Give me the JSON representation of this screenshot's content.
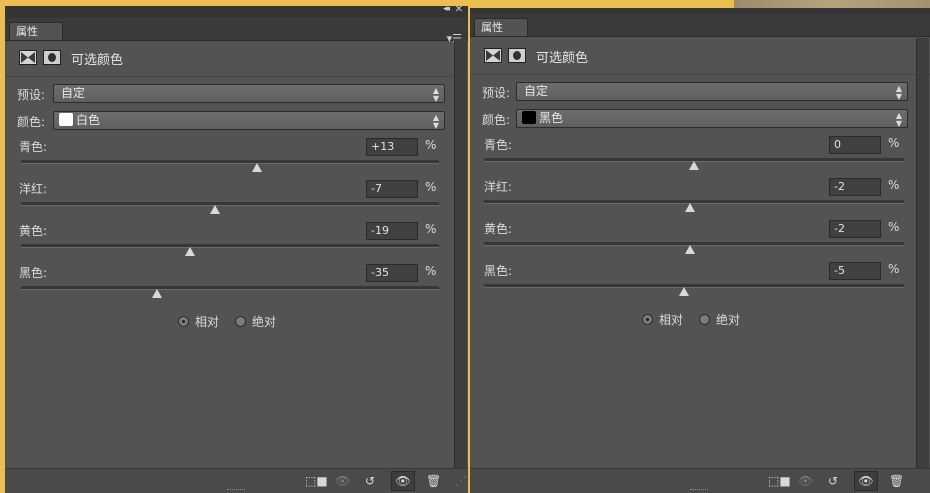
{
  "panels": [
    {
      "tab": "属性",
      "title": "可选颜色",
      "preset_label": "预设:",
      "preset_value": "自定",
      "color_label": "颜色:",
      "color_value": "白色",
      "swatch_color": "#ffffff",
      "sliders": [
        {
          "label": "青色:",
          "value": "+13",
          "unit": "%",
          "percent": 13
        },
        {
          "label": "洋红:",
          "value": "-7",
          "unit": "%",
          "percent": -7
        },
        {
          "label": "黄色:",
          "value": "-19",
          "unit": "%",
          "percent": -19
        },
        {
          "label": "黑色:",
          "value": "-35",
          "unit": "%",
          "percent": -35
        }
      ],
      "method_relative": "相对",
      "method_absolute": "绝对",
      "selected_method": "relative"
    },
    {
      "tab": "属性",
      "title": "可选颜色",
      "preset_label": "预设:",
      "preset_value": "自定",
      "color_label": "颜色:",
      "color_value": "黑色",
      "swatch_color": "#000000",
      "sliders": [
        {
          "label": "青色:",
          "value": "0",
          "unit": "%",
          "percent": 0
        },
        {
          "label": "洋红:",
          "value": "-2",
          "unit": "%",
          "percent": -2
        },
        {
          "label": "黄色:",
          "value": "-2",
          "unit": "%",
          "percent": -2
        },
        {
          "label": "黑色:",
          "value": "-5",
          "unit": "%",
          "percent": -5
        }
      ],
      "method_relative": "相对",
      "method_absolute": "绝对",
      "selected_method": "relative"
    }
  ],
  "icons": {
    "collapse": "double-chevron-left-icon",
    "close": "close-icon",
    "menu": "panel-menu-icon",
    "clip": "clip-to-layer-icon",
    "view_previous": "view-previous-state-icon",
    "reset": "reset-icon",
    "visibility": "eye-icon",
    "delete": "trash-icon"
  },
  "colors": {
    "accent_border": "#e9bf4f",
    "panel_bg": "#535353"
  }
}
